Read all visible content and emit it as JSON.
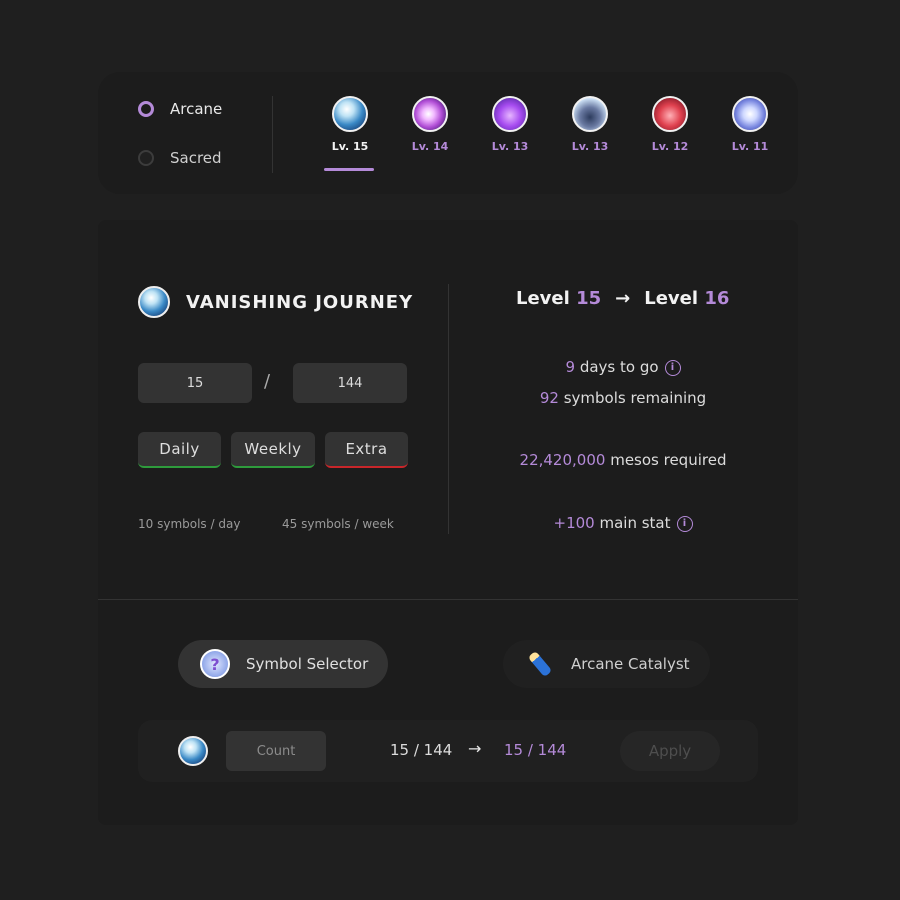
{
  "region_toggle": {
    "options": [
      {
        "label": "Arcane",
        "selected": true
      },
      {
        "label": "Sacred",
        "selected": false
      }
    ]
  },
  "symbol_tabs": [
    {
      "icon": "vanishing-journey-icon",
      "level": "Lv. 15",
      "active": true
    },
    {
      "icon": "chu-chu-icon",
      "level": "Lv. 14",
      "active": false
    },
    {
      "icon": "lachelein-icon",
      "level": "Lv. 13",
      "active": false
    },
    {
      "icon": "arcana-icon",
      "level": "Lv. 13",
      "active": false
    },
    {
      "icon": "morass-icon",
      "level": "Lv. 12",
      "active": false
    },
    {
      "icon": "esfera-icon",
      "level": "Lv. 11",
      "active": false
    }
  ],
  "symbol": {
    "name": "VANISHING JOURNEY",
    "current_count": "15",
    "required_count": "144",
    "slash": "/"
  },
  "quests": [
    {
      "label": "Daily",
      "state": "on"
    },
    {
      "label": "Weekly",
      "state": "on"
    },
    {
      "label": "Extra",
      "state": "off"
    }
  ],
  "rates": {
    "daily": "10 symbols / day",
    "weekly": "45 symbols / week"
  },
  "levels": {
    "label_prefix": "Level",
    "current": "15",
    "next": "16",
    "arrow": "→"
  },
  "stats": {
    "days_value": "9",
    "days_text": "days to go",
    "remaining_value": "92",
    "remaining_text": "symbols remaining",
    "mesos_value": "22,420,000",
    "mesos_text": "mesos required",
    "stat_value": "+100",
    "stat_text": "main stat",
    "info_glyph": "i"
  },
  "tools": {
    "selector_label": "Symbol Selector",
    "selector_glyph": "?",
    "catalyst_label": "Arcane Catalyst"
  },
  "exchange": {
    "count_placeholder": "Count",
    "before": "15 / 144",
    "arrow": "→",
    "after": "15 / 144",
    "apply_label": "Apply"
  },
  "colors": {
    "background": "#1f1f1f",
    "panel": "#1c1c1c",
    "accent": "#b48ad8",
    "quest_on": "#2e9b3c",
    "quest_off": "#c8262a"
  }
}
